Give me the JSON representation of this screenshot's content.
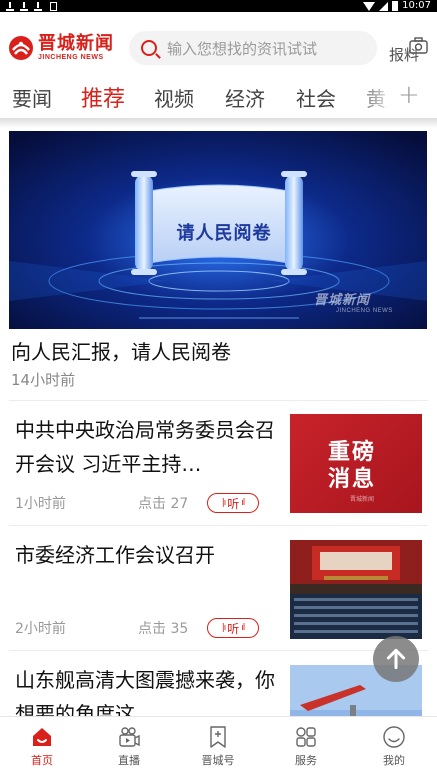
{
  "status_bar": {
    "time": "10:07"
  },
  "header": {
    "logo_cn": "晋城新闻",
    "logo_en": "JINCHENG NEWS",
    "search_placeholder": "输入您想找的资讯试试",
    "report_label": "报料"
  },
  "tabs": [
    {
      "label": "要闻",
      "active": false
    },
    {
      "label": "推荐",
      "active": true
    },
    {
      "label": "视频",
      "active": false
    },
    {
      "label": "经济",
      "active": false
    },
    {
      "label": "社会",
      "active": false
    },
    {
      "label": "黄",
      "active": false
    }
  ],
  "feed": {
    "banner": {
      "scroll_text": "请人民阅卷",
      "watermark_cn": "晋城新闻",
      "watermark_en": "JINCHENG NEWS"
    },
    "top_story": {
      "title": "向人民汇报，请人民阅卷",
      "time": "14小时前"
    },
    "articles": [
      {
        "title": "中共中央政治局常务委员会召开会议 习近平主持…",
        "time": "1小时前",
        "clicks": "点击 27",
        "listen": "听",
        "thumb_line1": "重磅",
        "thumb_line2": "消息",
        "thumb_small": "晋城新闻"
      },
      {
        "title": "市委经济工作会议召开",
        "time": "2小时前",
        "clicks": "点击 35",
        "listen": "听"
      },
      {
        "title": "山东舰高清大图震撼来袭，你想要的角度这…"
      }
    ]
  },
  "bottom_nav": [
    {
      "label": "首页",
      "icon": "home-icon",
      "active": true
    },
    {
      "label": "直播",
      "icon": "live-camera-icon",
      "active": false
    },
    {
      "label": "晋城号",
      "icon": "bookmark-plus-icon",
      "active": false
    },
    {
      "label": "服务",
      "icon": "grid-icon",
      "active": false
    },
    {
      "label": "我的",
      "icon": "profile-icon",
      "active": false
    }
  ],
  "colors": {
    "brand_red": "#d9201b",
    "banner_blue": "#0a1b5e"
  }
}
